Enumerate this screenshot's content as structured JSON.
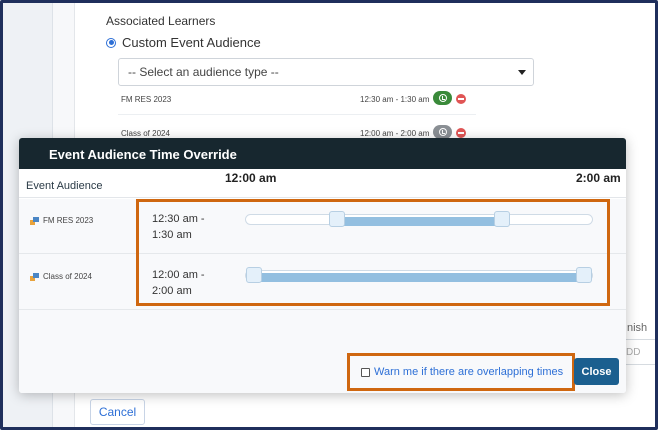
{
  "background": {
    "associated_learners_label": "Associated Learners",
    "custom_event_audience_label": "Custom Event Audience",
    "audience_type_select_value": "-- Select an audience type --",
    "audiences": [
      {
        "name": "FM RES 2023",
        "time": "12:30 am - 1:30 am",
        "clock_color": "#3a8a3a"
      },
      {
        "name": "Class of 2024",
        "time": "12:00 am - 2:00 am",
        "clock_color": "#8a8f94"
      }
    ],
    "finish_label": "nish",
    "finish_placeholder": "DD",
    "cancel_label": "Cancel"
  },
  "modal": {
    "title": "Event Audience Time Override",
    "column_audience": "Event Audience",
    "range_start": "12:00 am",
    "range_end": "2:00 am",
    "rows": [
      {
        "name": "FM RES 2023",
        "time_line1": "12:30 am -",
        "time_line2": "1:30 am",
        "start_fraction": 0.25,
        "end_fraction": 0.75
      },
      {
        "name": "Class of 2024",
        "time_line1": "12:00 am -",
        "time_line2": "2:00 am",
        "start_fraction": 0.0,
        "end_fraction": 1.0
      }
    ],
    "warn_label": "Warn me if there are overlapping times",
    "warn_checked": false,
    "close_label": "Close"
  },
  "colors": {
    "header_bg": "#17272f",
    "accent_blue": "#2d6fd6",
    "close_button": "#1b5f8f",
    "highlight_orange": "#cf6710",
    "slider_fill": "#93bfe0"
  }
}
